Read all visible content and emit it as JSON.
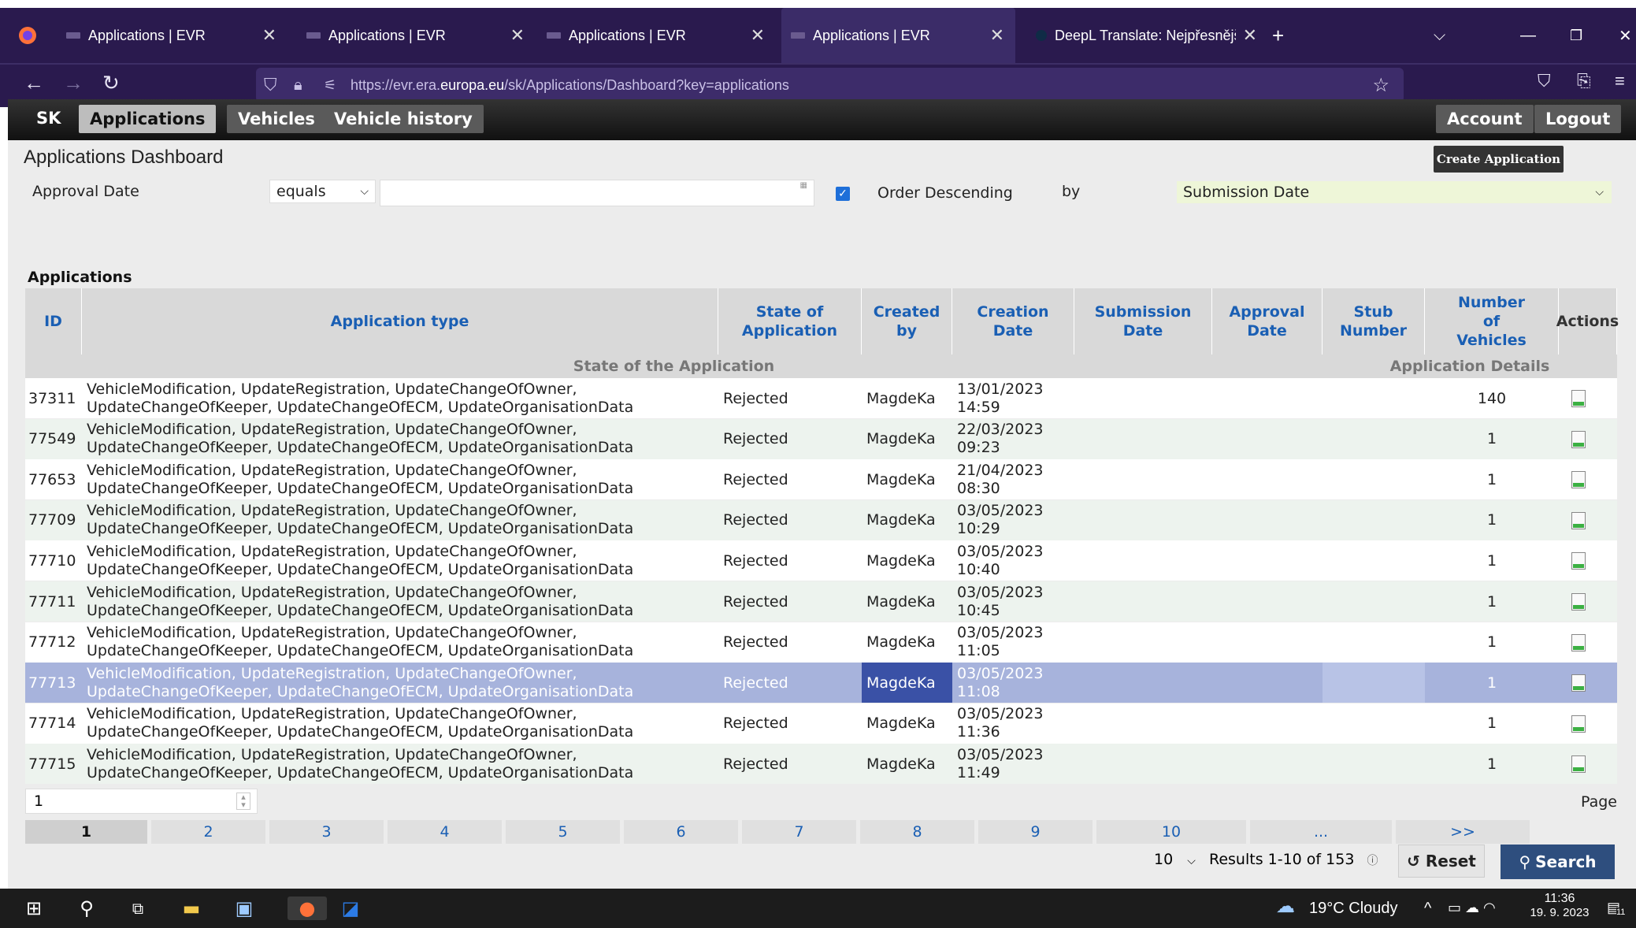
{
  "browser": {
    "tabs": [
      {
        "label": "Applications | EVR"
      },
      {
        "label": "Applications | EVR"
      },
      {
        "label": "Applications | EVR"
      },
      {
        "label": "Applications | EVR"
      },
      {
        "label": "DeepL Translate: Nejpřesnější p"
      }
    ],
    "url_prefix": "https://evr.era.",
    "url_domain": "europa.eu",
    "url_path": "/sk/Applications/Dashboard?key=applications"
  },
  "appbar": {
    "lang": "SK",
    "nav": [
      "Applications",
      "Vehicles",
      "Vehicle history"
    ],
    "account": "Account",
    "logout": "Logout"
  },
  "page": {
    "title": "Applications Dashboard",
    "create_label": "Create Application",
    "filter": {
      "field": "Approval Date",
      "operator": "equals",
      "value": "",
      "order_desc_label": "Order Descending",
      "by_label": "by",
      "order_by": "Submission Date"
    },
    "section_title": "Applications"
  },
  "grid": {
    "headers": {
      "id": "ID",
      "type": "Application type",
      "state": "State of Application",
      "created_by": "Created by",
      "creation_date": "Creation Date",
      "submission_date": "Submission Date",
      "approval_date": "Approval Date",
      "stub": "Stub Number",
      "vehicles": "Number of Vehicles",
      "actions": "Actions"
    },
    "group_state": "State of the Application",
    "group_details": "Application Details",
    "rows": [
      {
        "id": "37311",
        "type": "VehicleModification, UpdateRegistration, UpdateChangeOfOwner,\nUpdateChangeOfKeeper, UpdateChangeOfECM, UpdateOrganisationData",
        "state": "Rejected",
        "created_by": "MagdeKa",
        "creation_date": "13/01/2023\n14:59",
        "submission_date": "",
        "approval_date": "",
        "stub": "",
        "vehicles": "140"
      },
      {
        "id": "77549",
        "type": "VehicleModification, UpdateRegistration, UpdateChangeOfOwner,\nUpdateChangeOfKeeper, UpdateChangeOfECM, UpdateOrganisationData",
        "state": "Rejected",
        "created_by": "MagdeKa",
        "creation_date": "22/03/2023\n09:23",
        "submission_date": "",
        "approval_date": "",
        "stub": "",
        "vehicles": "1"
      },
      {
        "id": "77653",
        "type": "VehicleModification, UpdateRegistration, UpdateChangeOfOwner,\nUpdateChangeOfKeeper, UpdateChangeOfECM, UpdateOrganisationData",
        "state": "Rejected",
        "created_by": "MagdeKa",
        "creation_date": "21/04/2023\n08:30",
        "submission_date": "",
        "approval_date": "",
        "stub": "",
        "vehicles": "1"
      },
      {
        "id": "77709",
        "type": "VehicleModification, UpdateRegistration, UpdateChangeOfOwner,\nUpdateChangeOfKeeper, UpdateChangeOfECM, UpdateOrganisationData",
        "state": "Rejected",
        "created_by": "MagdeKa",
        "creation_date": "03/05/2023\n10:29",
        "submission_date": "",
        "approval_date": "",
        "stub": "",
        "vehicles": "1"
      },
      {
        "id": "77710",
        "type": "VehicleModification, UpdateRegistration, UpdateChangeOfOwner,\nUpdateChangeOfKeeper, UpdateChangeOfECM, UpdateOrganisationData",
        "state": "Rejected",
        "created_by": "MagdeKa",
        "creation_date": "03/05/2023\n10:40",
        "submission_date": "",
        "approval_date": "",
        "stub": "",
        "vehicles": "1"
      },
      {
        "id": "77711",
        "type": "VehicleModification, UpdateRegistration, UpdateChangeOfOwner,\nUpdateChangeOfKeeper, UpdateChangeOfECM, UpdateOrganisationData",
        "state": "Rejected",
        "created_by": "MagdeKa",
        "creation_date": "03/05/2023\n10:45",
        "submission_date": "",
        "approval_date": "",
        "stub": "",
        "vehicles": "1"
      },
      {
        "id": "77712",
        "type": "VehicleModification, UpdateRegistration, UpdateChangeOfOwner,\nUpdateChangeOfKeeper, UpdateChangeOfECM, UpdateOrganisationData",
        "state": "Rejected",
        "created_by": "MagdeKa",
        "creation_date": "03/05/2023\n11:05",
        "submission_date": "",
        "approval_date": "",
        "stub": "",
        "vehicles": "1"
      },
      {
        "id": "77713",
        "type": "VehicleModification, UpdateRegistration, UpdateChangeOfOwner,\nUpdateChangeOfKeeper, UpdateChangeOfECM, UpdateOrganisationData",
        "state": "Rejected",
        "created_by": "MagdeKa",
        "creation_date": "03/05/2023\n11:08",
        "submission_date": "",
        "approval_date": "",
        "stub": "",
        "vehicles": "1"
      },
      {
        "id": "77714",
        "type": "VehicleModification, UpdateRegistration, UpdateChangeOfOwner,\nUpdateChangeOfKeeper, UpdateChangeOfECM, UpdateOrganisationData",
        "state": "Rejected",
        "created_by": "MagdeKa",
        "creation_date": "03/05/2023\n11:36",
        "submission_date": "",
        "approval_date": "",
        "stub": "",
        "vehicles": "1"
      },
      {
        "id": "77715",
        "type": "VehicleModification, UpdateRegistration, UpdateChangeOfOwner,\nUpdateChangeOfKeeper, UpdateChangeOfECM, UpdateOrganisationData",
        "state": "Rejected",
        "created_by": "MagdeKa",
        "creation_date": "03/05/2023\n11:49",
        "submission_date": "",
        "approval_date": "",
        "stub": "",
        "vehicles": "1"
      }
    ]
  },
  "pager": {
    "page_input": "1",
    "page_label": "Page",
    "pages": [
      "1",
      "2",
      "3",
      "4",
      "5",
      "6",
      "7",
      "8",
      "9",
      "10",
      "...",
      ">>"
    ],
    "page_size": "10",
    "results": "Results 1-10 of 153",
    "reset": "↺ Reset",
    "search": "Search"
  },
  "taskbar": {
    "weather": "19°C  Cloudy",
    "time": "11:36",
    "date": "19. 9. 2023",
    "notif": "11"
  }
}
